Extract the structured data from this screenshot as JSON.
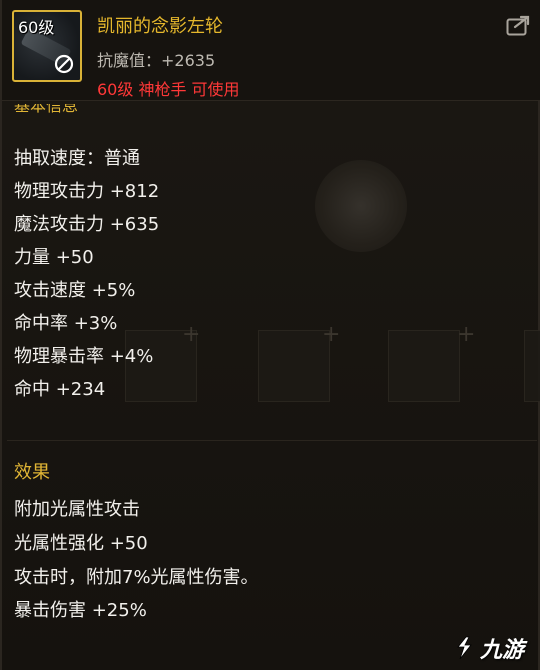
{
  "item": {
    "level_badge": "60级",
    "name": "凯丽的念影左轮",
    "anti_magic": "抗魔值：+2635",
    "requirement": "60级 神枪手 可使用",
    "name_color": "#e5b72c",
    "requirement_color": "#ff3838"
  },
  "basic_info": {
    "title": "基本信息",
    "stats": [
      "抽取速度：普通",
      "物理攻击力 +812",
      "魔法攻击力 +635",
      "力量 +50",
      "攻击速度 +5%",
      "命中率 +3%",
      "物理暴击率 +4%",
      "命中 +234"
    ]
  },
  "effects": {
    "title": "效果",
    "lines": [
      "附加光属性攻击",
      "光属性强化 +50",
      "攻击时，附加7%光属性伤害。",
      "暴击伤害 +25%"
    ]
  },
  "icons": {
    "item": "revolver-icon",
    "ban": "no-entry-icon",
    "share": "share-icon"
  },
  "watermark": "九游"
}
